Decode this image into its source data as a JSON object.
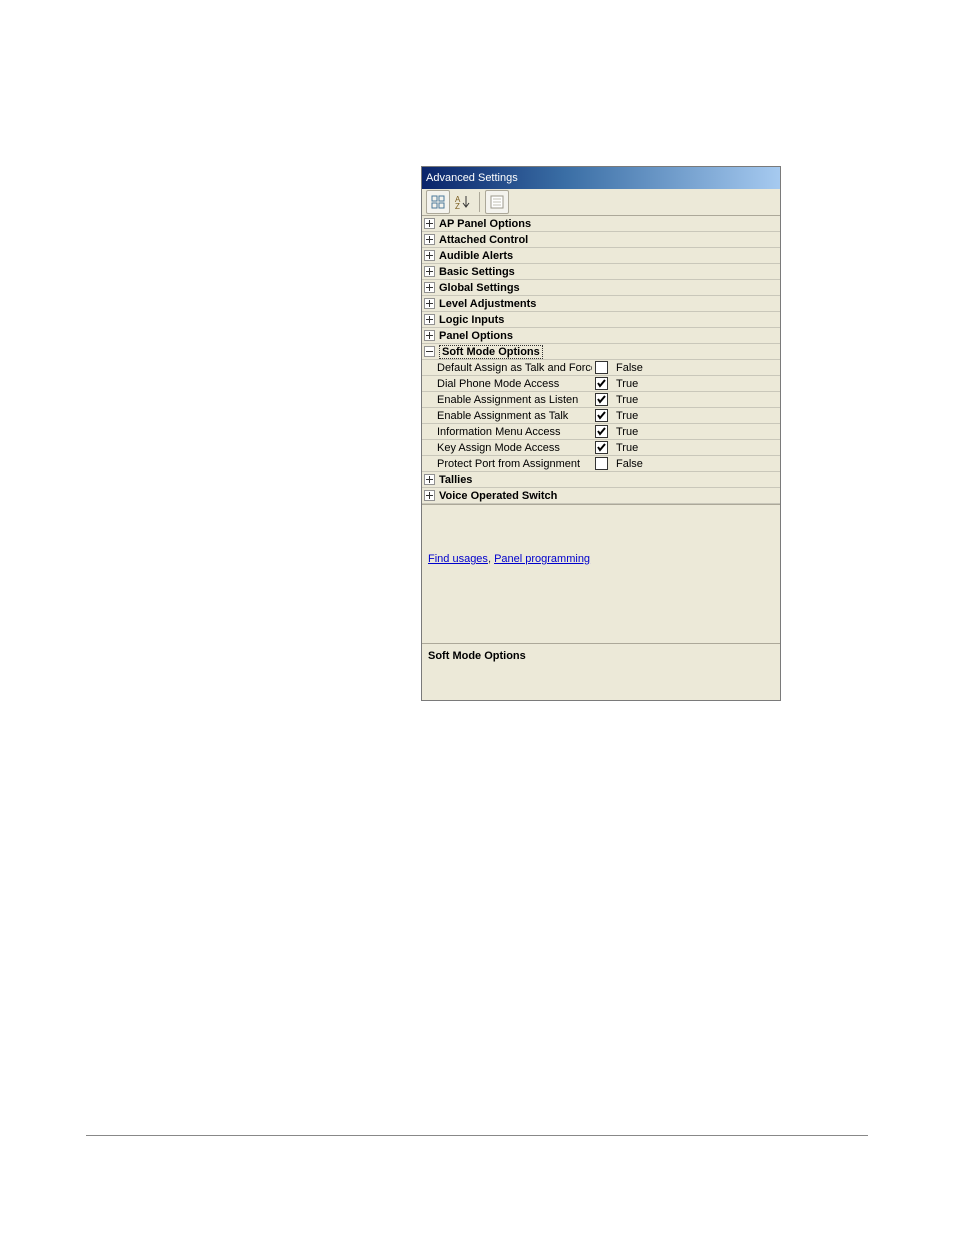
{
  "window": {
    "title": "Advanced Settings"
  },
  "categories": [
    {
      "label": "AP Panel Options",
      "expanded": false
    },
    {
      "label": "Attached Control",
      "expanded": false
    },
    {
      "label": "Audible Alerts",
      "expanded": false
    },
    {
      "label": "Basic Settings",
      "expanded": false
    },
    {
      "label": "Global Settings",
      "expanded": false
    },
    {
      "label": "Level Adjustments",
      "expanded": false
    },
    {
      "label": "Logic Inputs",
      "expanded": false
    },
    {
      "label": "Panel Options",
      "expanded": false
    },
    {
      "label": "Soft Mode Options",
      "expanded": true,
      "selected": true,
      "items": [
        {
          "name": "Default Assign as Talk and Force",
          "checked": false,
          "value": "False"
        },
        {
          "name": "Dial Phone Mode Access",
          "checked": true,
          "value": "True"
        },
        {
          "name": "Enable Assignment as Listen",
          "checked": true,
          "value": "True"
        },
        {
          "name": "Enable Assignment as Talk",
          "checked": true,
          "value": "True"
        },
        {
          "name": "Information Menu Access",
          "checked": true,
          "value": "True"
        },
        {
          "name": "Key Assign Mode Access",
          "checked": true,
          "value": "True"
        },
        {
          "name": "Protect Port from Assignment",
          "checked": false,
          "value": "False"
        }
      ]
    },
    {
      "label": "Tallies",
      "expanded": false
    },
    {
      "label": "Voice Operated Switch",
      "expanded": false
    }
  ],
  "links": {
    "find_usages": "Find usages",
    "separator": ", ",
    "panel_programming": "Panel programming"
  },
  "description": {
    "title": "Soft Mode Options"
  }
}
